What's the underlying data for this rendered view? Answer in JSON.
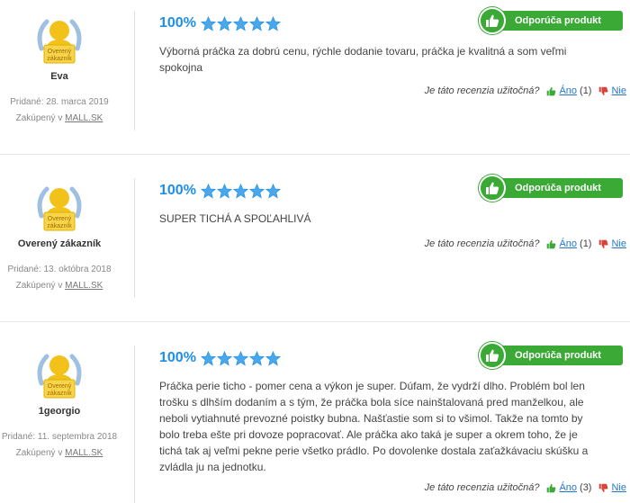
{
  "reviews": [
    {
      "user": "Eva",
      "badge_label": "Overený zákazník",
      "added": "Pridané: 28. marca 2019",
      "bought_prefix": "Zakúpený v",
      "bought_store": "MALL.SK",
      "percent": "100%",
      "stars": 5,
      "recommend_label": "Odporúča produkt",
      "text": "Výborná práčka za dobrú cenu, rýchle dodanie tovaru, práčka je kvalitná a som veľmi spokojna",
      "helpful_question": "Je táto recenzia užitočná?",
      "yes_label": "Áno",
      "yes_count": "(1)",
      "no_label": "Nie"
    },
    {
      "user": "Overený zákazník",
      "badge_label": "Overený zákazník",
      "added": "Pridané: 13. októbra 2018",
      "bought_prefix": "Zakúpený v",
      "bought_store": "MALL.SK",
      "percent": "100%",
      "stars": 5,
      "recommend_label": "Odporúča produkt",
      "text": "SUPER TICHÁ A SPOĽAHLIVÁ",
      "helpful_question": "Je táto recenzia užitočná?",
      "yes_label": "Áno",
      "yes_count": "(1)",
      "no_label": "Nie"
    },
    {
      "user": "1georgio",
      "badge_label": "Overený zákazník",
      "added": "Pridané: 11. septembra 2018",
      "bought_prefix": "Zakúpený v",
      "bought_store": "MALL.SK",
      "percent": "100%",
      "stars": 5,
      "recommend_label": "Odporúča produkt",
      "text": "Práčka perie ticho - pomer cena a výkon je super. Dúfam, že vydrží dlho. Problém bol len trošku s dlhším dodaním a s tým, že práčka bola síce nainštalovaná pred manželkou, ale neboli vytiahnuté prevozné poistky bubna. Našťastie som si to všimol. Takže na tomto by bolo treba ešte pri dovoze popracovať. Ale práčka ako taká je super a okrem toho, že je tichá tak aj veľmi pekne perie všetko prádlo. Po dovolenke dostala zaťažkávaciu skúšku a zvládla ju na jednotku.",
      "helpful_question": "Je táto recenzia užitočná?",
      "yes_label": "Áno",
      "yes_count": "(3)",
      "no_label": "Nie"
    }
  ],
  "colors": {
    "accent_blue": "#1e8ee6",
    "recommend_green": "#3aa935",
    "thumb_down_red": "#d9443a"
  },
  "icons": [
    "verified-customer-badge-icon",
    "star-icon",
    "thumbs-up-icon",
    "thumbs-down-icon"
  ]
}
